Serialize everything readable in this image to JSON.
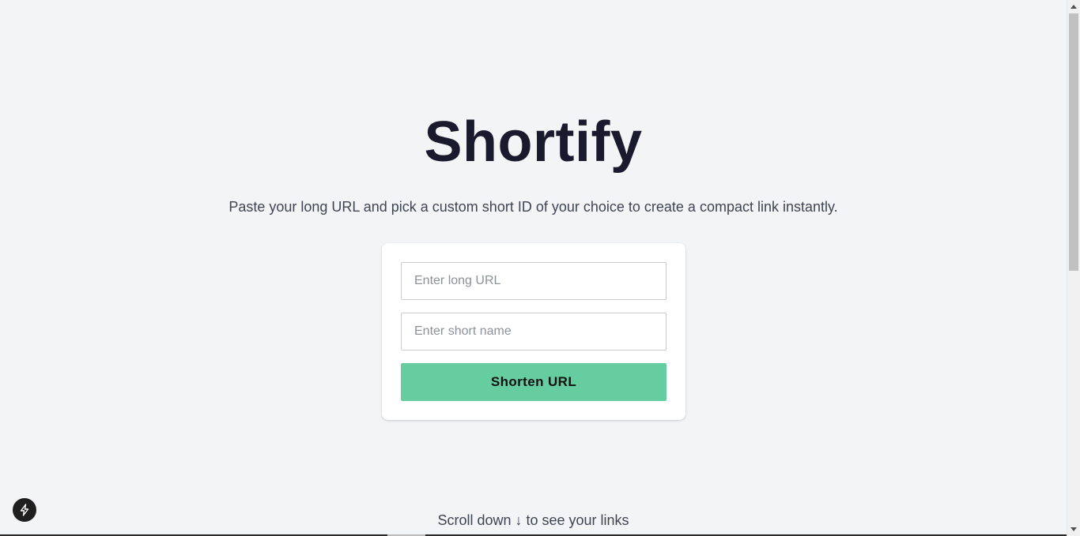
{
  "app": {
    "title": "Shortify",
    "subtitle": "Paste your long URL and pick a custom short ID of your choice to create a compact link instantly."
  },
  "form": {
    "long_url": {
      "value": "",
      "placeholder": "Enter long URL"
    },
    "short_name": {
      "value": "",
      "placeholder": "Enter short name"
    },
    "submit_label": "Shorten URL",
    "submit_color": "#66cda0"
  },
  "footer": {
    "scroll_hint": "Scroll down ↓ to see your links"
  },
  "dev_badge": {
    "icon": "lightning-bolt-icon"
  },
  "scrollbar": {
    "position_fraction": 0.0
  }
}
